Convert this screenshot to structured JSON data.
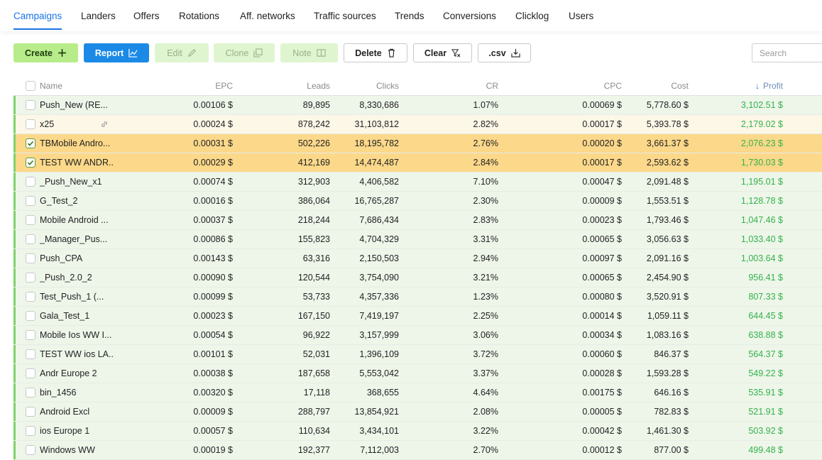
{
  "nav": {
    "tabs": [
      "Campaigns",
      "Landers",
      "Offers",
      "Rotations",
      "Aff. networks",
      "Traffic sources",
      "Trends",
      "Conversions",
      "Clicklog",
      "Users"
    ],
    "active": "Campaigns"
  },
  "toolbar": {
    "create": "Create",
    "report": "Report",
    "edit": "Edit",
    "clone": "Clone",
    "note": "Note",
    "delete": "Delete",
    "clear": "Clear",
    "csv": ".csv",
    "search_placeholder": "Search"
  },
  "colors": {
    "accent": "#1a73e8",
    "create_bg": "#b8ec8a",
    "report_bg": "#1b8ae6",
    "selected_row": "#fcd88a",
    "profit_green": "#33b24a"
  },
  "icons": {
    "create": "plus-icon",
    "report": "line-chart-icon",
    "edit": "pencil-icon",
    "clone": "copy-icon",
    "note": "book-icon",
    "delete": "trash-icon",
    "clear": "clear-filter-icon",
    "csv": "export-icon",
    "sort": "arrow-down-icon",
    "link": "link-icon"
  },
  "table": {
    "headers": {
      "name": "Name",
      "epc": "EPC",
      "leads": "Leads",
      "clicks": "Clicks",
      "cr": "CR",
      "cpc": "CPC",
      "cost": "Cost",
      "profit": "Profit"
    },
    "sorted_by": "profit",
    "rows": [
      {
        "name": "Push_New (RE...",
        "epc": "0.00106 $",
        "leads": "89,895",
        "clicks": "8,330,686",
        "cr": "1.07%",
        "cpc": "0.00069 $",
        "cost": "5,778.60 $",
        "profit": "3,102.51 $",
        "checked": false,
        "state": "green",
        "link": false
      },
      {
        "name": "x25",
        "epc": "0.00024 $",
        "leads": "878,242",
        "clicks": "31,103,812",
        "cr": "2.82%",
        "cpc": "0.00017 $",
        "cost": "5,393.78 $",
        "profit": "2,179.02 $",
        "checked": false,
        "state": "cream",
        "link": true
      },
      {
        "name": "TBMobile Andro...",
        "epc": "0.00031 $",
        "leads": "502,226",
        "clicks": "18,195,782",
        "cr": "2.76%",
        "cpc": "0.00020 $",
        "cost": "3,661.37 $",
        "profit": "2,076.23 $",
        "checked": true,
        "state": "selected",
        "link": false
      },
      {
        "name": "TEST WW ANDR...",
        "epc": "0.00029 $",
        "leads": "412,169",
        "clicks": "14,474,487",
        "cr": "2.84%",
        "cpc": "0.00017 $",
        "cost": "2,593.62 $",
        "profit": "1,730.03 $",
        "checked": true,
        "state": "selected",
        "link": false
      },
      {
        "name": "_Push_New_x1",
        "epc": "0.00074 $",
        "leads": "312,903",
        "clicks": "4,406,582",
        "cr": "7.10%",
        "cpc": "0.00047 $",
        "cost": "2,091.48 $",
        "profit": "1,195.01 $",
        "checked": false,
        "state": "green",
        "link": false
      },
      {
        "name": "G_Test_2",
        "epc": "0.00016 $",
        "leads": "386,064",
        "clicks": "16,765,287",
        "cr": "2.30%",
        "cpc": "0.00009 $",
        "cost": "1,553.51 $",
        "profit": "1,128.78 $",
        "checked": false,
        "state": "green",
        "link": false
      },
      {
        "name": "Mobile Android ...",
        "epc": "0.00037 $",
        "leads": "218,244",
        "clicks": "7,686,434",
        "cr": "2.83%",
        "cpc": "0.00023 $",
        "cost": "1,793.46 $",
        "profit": "1,047.46 $",
        "checked": false,
        "state": "green",
        "link": false
      },
      {
        "name": "_Manager_Pus...",
        "epc": "0.00086 $",
        "leads": "155,823",
        "clicks": "4,704,329",
        "cr": "3.31%",
        "cpc": "0.00065 $",
        "cost": "3,056.63 $",
        "profit": "1,033.40 $",
        "checked": false,
        "state": "green",
        "link": false
      },
      {
        "name": "Push_CPA",
        "epc": "0.00143 $",
        "leads": "63,316",
        "clicks": "2,150,503",
        "cr": "2.94%",
        "cpc": "0.00097 $",
        "cost": "2,091.16 $",
        "profit": "1,003.64 $",
        "checked": false,
        "state": "green",
        "link": false
      },
      {
        "name": "_Push_2.0_2",
        "epc": "0.00090 $",
        "leads": "120,544",
        "clicks": "3,754,090",
        "cr": "3.21%",
        "cpc": "0.00065 $",
        "cost": "2,454.90 $",
        "profit": "956.41 $",
        "checked": false,
        "state": "green",
        "link": false
      },
      {
        "name": "Test_Push_1 (...",
        "epc": "0.00099 $",
        "leads": "53,733",
        "clicks": "4,357,336",
        "cr": "1.23%",
        "cpc": "0.00080 $",
        "cost": "3,520.91 $",
        "profit": "807.33 $",
        "checked": false,
        "state": "green",
        "link": false
      },
      {
        "name": "Gala_Test_1",
        "epc": "0.00023 $",
        "leads": "167,150",
        "clicks": "7,419,197",
        "cr": "2.25%",
        "cpc": "0.00014 $",
        "cost": "1,059.11 $",
        "profit": "644.45 $",
        "checked": false,
        "state": "green",
        "link": false
      },
      {
        "name": "Mobile Ios WW I...",
        "epc": "0.00054 $",
        "leads": "96,922",
        "clicks": "3,157,999",
        "cr": "3.06%",
        "cpc": "0.00034 $",
        "cost": "1,083.16 $",
        "profit": "638.88 $",
        "checked": false,
        "state": "green",
        "link": false
      },
      {
        "name": "TEST WW ios LA...",
        "epc": "0.00101 $",
        "leads": "52,031",
        "clicks": "1,396,109",
        "cr": "3.72%",
        "cpc": "0.00060 $",
        "cost": "846.37 $",
        "profit": "564.37 $",
        "checked": false,
        "state": "green",
        "link": false
      },
      {
        "name": "Andr Europe 2",
        "epc": "0.00038 $",
        "leads": "187,658",
        "clicks": "5,553,042",
        "cr": "3.37%",
        "cpc": "0.00028 $",
        "cost": "1,593.28 $",
        "profit": "549.22 $",
        "checked": false,
        "state": "green",
        "link": false
      },
      {
        "name": "bin_1456",
        "epc": "0.00320 $",
        "leads": "17,118",
        "clicks": "368,655",
        "cr": "4.64%",
        "cpc": "0.00175 $",
        "cost": "646.16 $",
        "profit": "535.91 $",
        "checked": false,
        "state": "green",
        "link": false
      },
      {
        "name": "Android Excl",
        "epc": "0.00009 $",
        "leads": "288,797",
        "clicks": "13,854,921",
        "cr": "2.08%",
        "cpc": "0.00005 $",
        "cost": "782.83 $",
        "profit": "521.91 $",
        "checked": false,
        "state": "green",
        "link": false
      },
      {
        "name": "ios Europe 1",
        "epc": "0.00057 $",
        "leads": "110,634",
        "clicks": "3,434,101",
        "cr": "3.22%",
        "cpc": "0.00042 $",
        "cost": "1,461.30 $",
        "profit": "503.92 $",
        "checked": false,
        "state": "green",
        "link": false
      },
      {
        "name": "Windows WW",
        "epc": "0.00019 $",
        "leads": "192,377",
        "clicks": "7,112,003",
        "cr": "2.70%",
        "cpc": "0.00012 $",
        "cost": "877.00 $",
        "profit": "499.48 $",
        "checked": false,
        "state": "green",
        "link": false
      }
    ]
  }
}
